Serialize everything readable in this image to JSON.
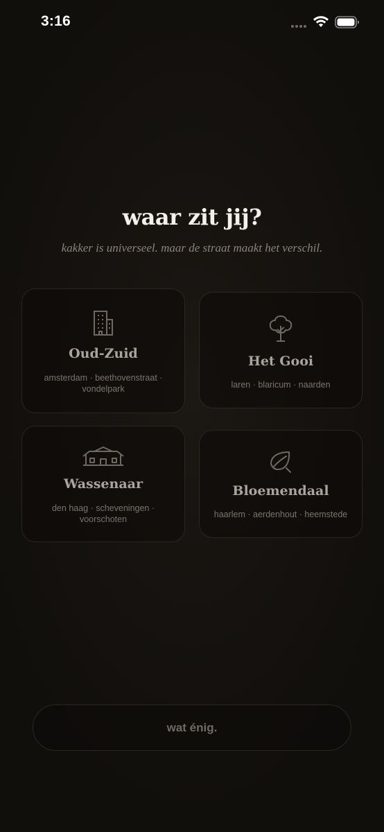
{
  "status_bar": {
    "time": "3:16"
  },
  "header": {
    "title": "waar zit jij?",
    "subtitle": "kakker is universeel. maar de straat maakt het verschil."
  },
  "cards": [
    {
      "title": "Oud-Zuid",
      "subtitle": "amsterdam · beethovenstraat · vondelpark",
      "icon": "building-icon"
    },
    {
      "title": "Het Gooi",
      "subtitle": "laren · blaricum · naarden",
      "icon": "tree-icon"
    },
    {
      "title": "Wassenaar",
      "subtitle": "den haag · scheveningen · voorschoten",
      "icon": "villa-icon"
    },
    {
      "title": "Bloemendaal",
      "subtitle": "haarlem · aerdenhout · heemstede",
      "icon": "leaf-icon"
    }
  ],
  "continue_button": {
    "label": "wat énig."
  },
  "colors": {
    "background": "#15120f",
    "card_border": "#2a2622",
    "title_text": "#f3efe9",
    "muted_text": "#8a847c"
  }
}
